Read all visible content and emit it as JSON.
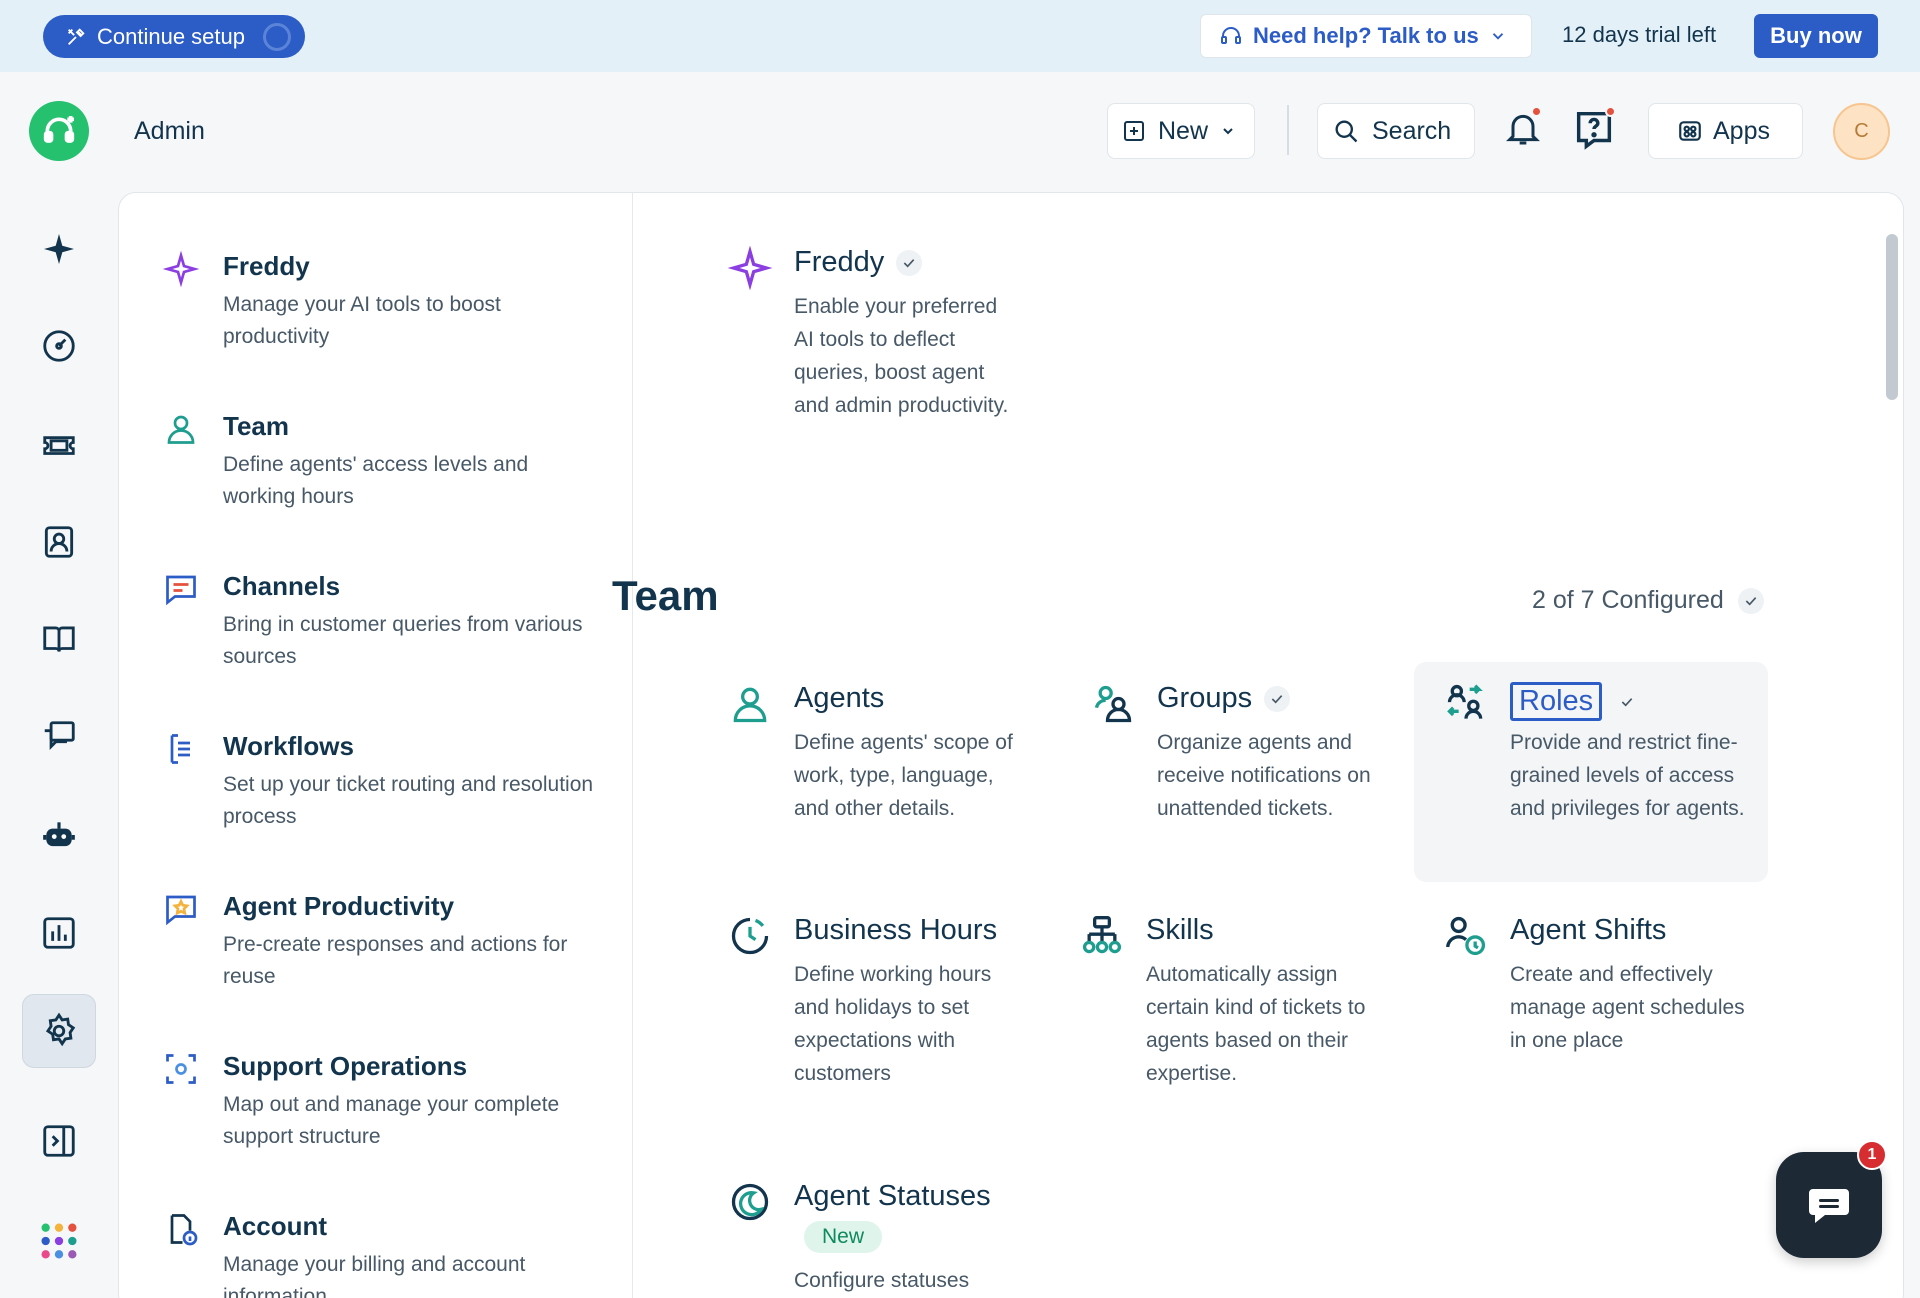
{
  "banner": {
    "continue_setup": "Continue setup",
    "help": "Need help? Talk to us",
    "trial": "12 days trial left",
    "buy": "Buy now"
  },
  "header": {
    "title": "Admin",
    "new_label": "New",
    "search_label": "Search",
    "apps_label": "Apps",
    "avatar_initial": "C"
  },
  "menu": {
    "items": [
      {
        "title": "Freddy",
        "desc": "Manage your AI tools to boost productivity"
      },
      {
        "title": "Team",
        "desc": "Define agents' access levels and working hours"
      },
      {
        "title": "Channels",
        "desc": "Bring in customer queries from various sources"
      },
      {
        "title": "Workflows",
        "desc": "Set up your ticket routing and resolution process"
      },
      {
        "title": "Agent Productivity",
        "desc": "Pre-create responses and actions for reuse"
      },
      {
        "title": "Support Operations",
        "desc": "Map out and manage your complete support structure"
      },
      {
        "title": "Account",
        "desc": "Manage your billing and account information"
      }
    ]
  },
  "content": {
    "freddy": {
      "title": "Freddy",
      "desc": "Enable your preferred AI tools to deflect queries, boost agent and admin productivity."
    },
    "team_section": {
      "title": "Team",
      "configured": "2 of 7 Configured"
    },
    "features": [
      {
        "title": "Agents",
        "desc": "Define agents' scope of work, type, language, and other details."
      },
      {
        "title": "Groups",
        "desc": "Organize agents and receive notifications on unattended tickets."
      },
      {
        "title": "Roles",
        "desc": "Provide and restrict fine-grained levels of access and privileges for agents."
      },
      {
        "title": "Business Hours",
        "desc": "Define working hours and holidays to set expectations with customers"
      },
      {
        "title": "Skills",
        "desc": "Automatically assign certain kind of tickets to agents based on their expertise."
      },
      {
        "title": "Agent Shifts",
        "desc": "Create and effectively manage agent schedules in one place"
      },
      {
        "title": "Agent Statuses",
        "desc": "Configure statuses",
        "badge": "New"
      }
    ]
  },
  "chat": {
    "badge": "1"
  },
  "colors": {
    "accent": "#2c5cc5",
    "brand": "#25c16f",
    "teal": "#1e9e8f",
    "freddy": "#8b3fe0"
  }
}
